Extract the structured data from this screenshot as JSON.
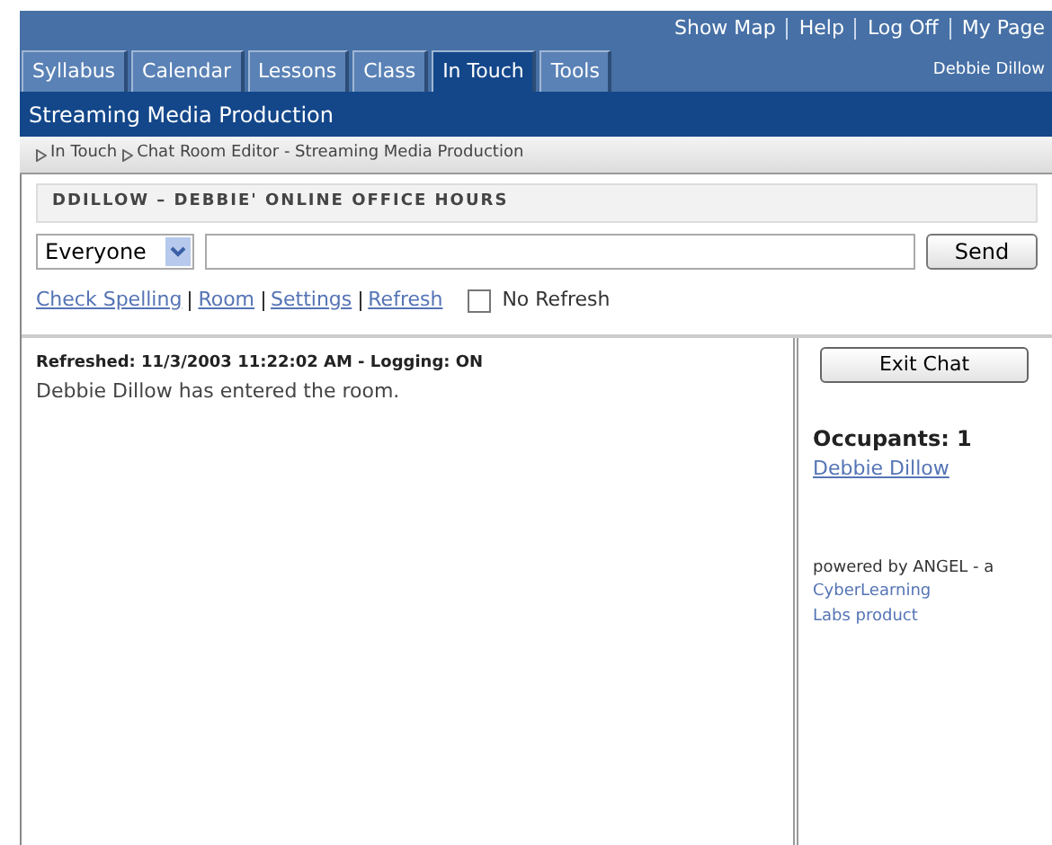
{
  "top_links": [
    "Show Map",
    "Help",
    "Log Off",
    "My Page"
  ],
  "tabs": [
    {
      "label": "Syllabus",
      "selected": false
    },
    {
      "label": "Calendar",
      "selected": false
    },
    {
      "label": "Lessons",
      "selected": false
    },
    {
      "label": "Class",
      "selected": false
    },
    {
      "label": "In Touch",
      "selected": true
    },
    {
      "label": "Tools",
      "selected": false
    }
  ],
  "user_name": "Debbie Dillow",
  "course_title": "Streaming Media Production",
  "breadcrumb": [
    "In Touch",
    "Chat Room Editor - Streaming Media Production"
  ],
  "room_title": "DDILLOW – DEBBIE' ONLINE OFFICE HOURS",
  "recipient": "Everyone",
  "send_button": "Send",
  "links": [
    "Check Spelling",
    "Room",
    "Settings",
    "Refresh"
  ],
  "no_refresh": {
    "label": "No Refresh",
    "checked": false
  },
  "chat": {
    "status": "Refreshed: 11/3/2003 11:22:02 AM - Logging: ON",
    "messages": [
      "Debbie Dillow has entered the room."
    ]
  },
  "side": {
    "exit_button": "Exit Chat",
    "occupants_label": "Occupants: 1",
    "occupants": [
      "Debbie Dillow"
    ],
    "powered_by": "powered by ANGEL - a",
    "product_link": "CyberLearning Labs product"
  }
}
